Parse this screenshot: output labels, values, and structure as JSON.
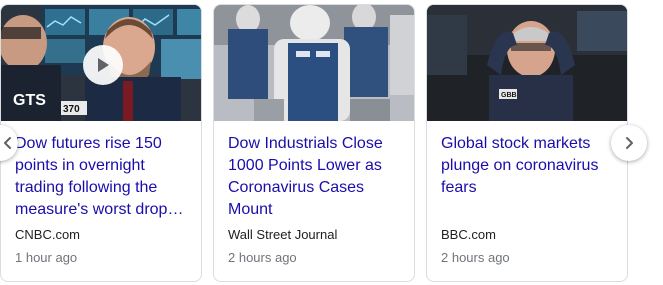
{
  "carousel": {
    "cards": [
      {
        "headline": "Dow futures rise 150 points in overnight trading following the measure's worst drop…",
        "source": "CNBC.com",
        "time": "1 hour ago",
        "thumb_text": "GTS",
        "thumb_number": "370",
        "has_video": true
      },
      {
        "headline": "Dow Industrials Close 1000 Points Lower as Coronavirus Cases Mount",
        "source": "Wall Street Journal",
        "time": "2 hours ago",
        "thumb_text_left": "",
        "thumb_text_right": ""
      },
      {
        "headline": "Global stock markets plunge on coronavirus fears",
        "source": "BBC.com",
        "time": "2 hours ago",
        "thumb_badge": "GBB"
      }
    ],
    "prev_icon": "chevron-left-icon",
    "next_icon": "chevron-right-icon"
  },
  "colors": {
    "headline": "#1a0dab",
    "source": "#202124",
    "time": "#70757a",
    "border": "#dadce0"
  }
}
